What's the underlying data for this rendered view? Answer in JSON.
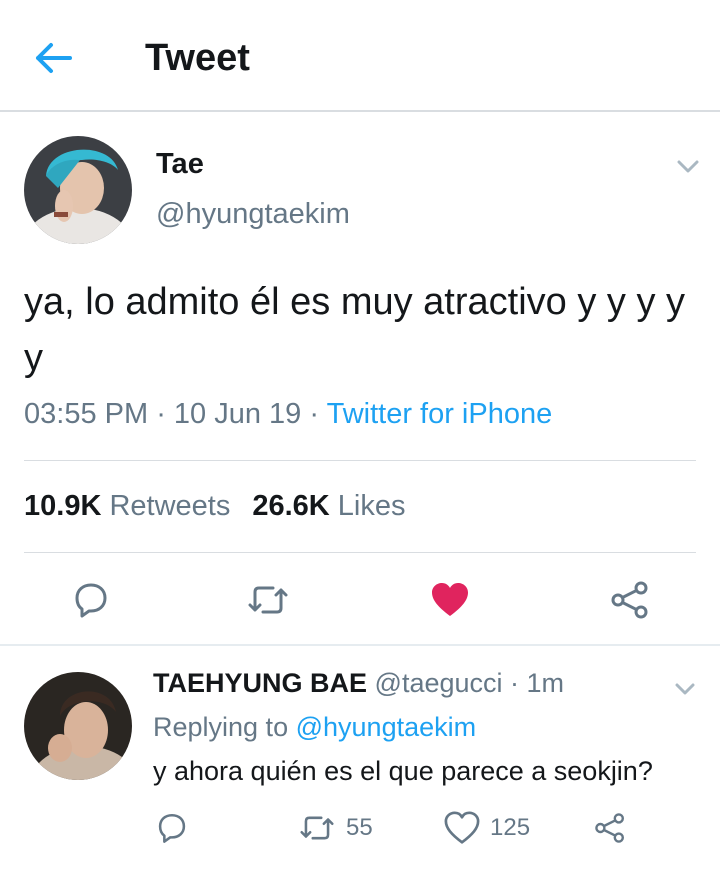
{
  "header": {
    "title": "Tweet",
    "accent_color": "#1da1f2"
  },
  "tweet": {
    "author_name": "Tae",
    "author_handle": "@hyungtaekim",
    "text": "ya, lo admito él es muy atractivo y y y y y",
    "time": "03:55 PM",
    "date": "10 Jun 19",
    "source": "Twitter for iPhone",
    "retweets_count": "10.9K",
    "retweets_label": "Retweets",
    "likes_count": "26.6K",
    "likes_label": "Likes",
    "liked": true,
    "like_color": "#e0245e",
    "actions": [
      "reply-icon",
      "retweet-icon",
      "heart-icon",
      "share-icon"
    ]
  },
  "reply": {
    "author_name": "TAEHYUNG BAE",
    "author_handle": "@taegucci",
    "time": "1m",
    "replying_prefix": "Replying to",
    "replying_to": "@hyungtaekim",
    "text": "y ahora quién es el que parece a seokjin?",
    "retweets_count": "55",
    "likes_count": "125",
    "actions": [
      "reply-icon",
      "retweet-icon",
      "heart-outline-icon",
      "share-icon"
    ]
  }
}
